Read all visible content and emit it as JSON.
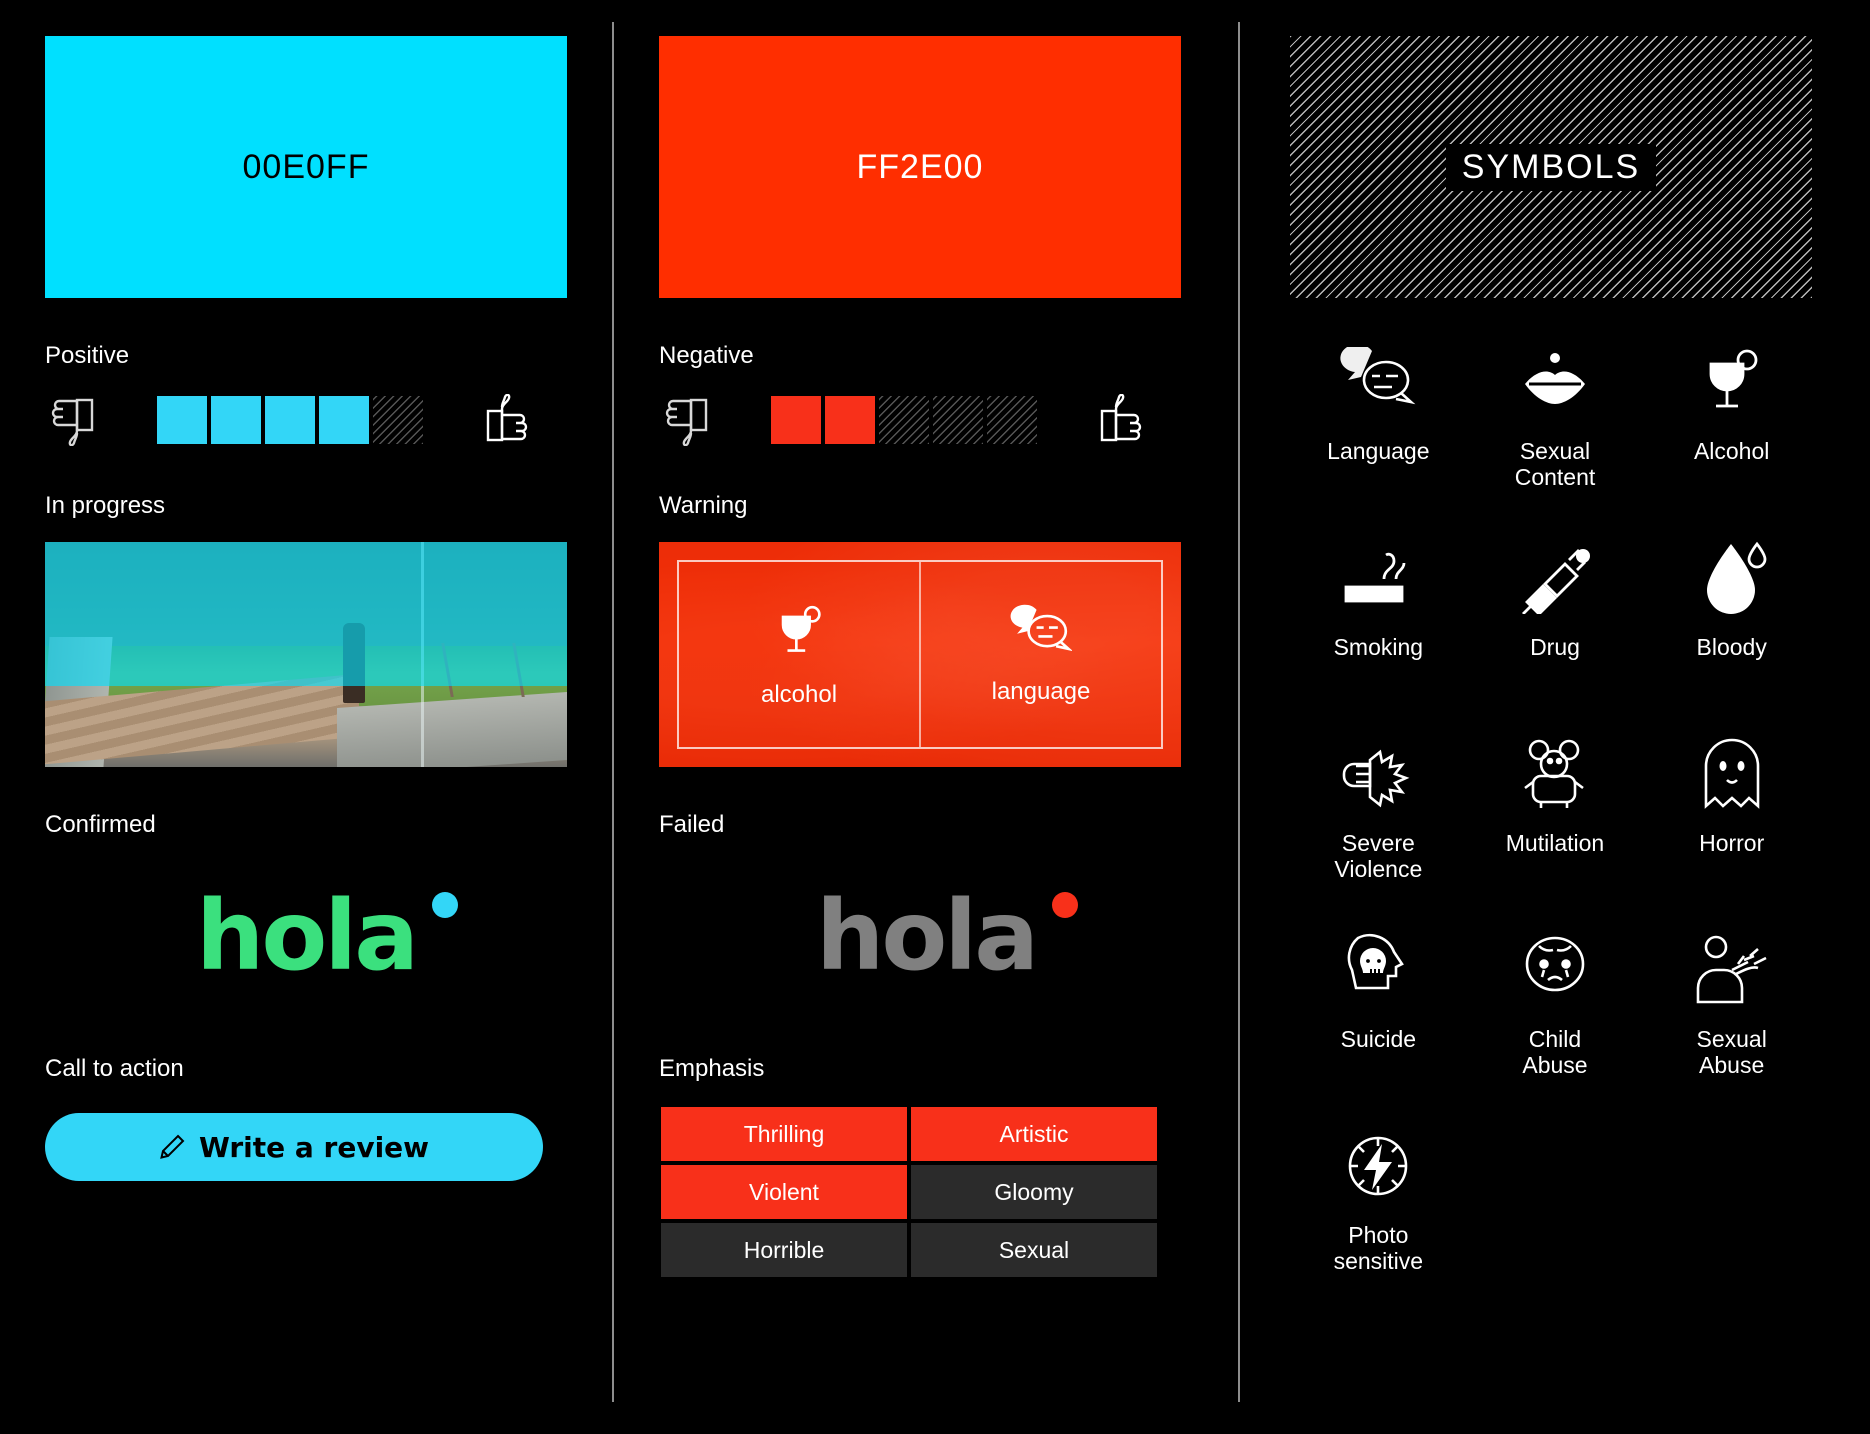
{
  "columns": {
    "primary": {
      "swatch": {
        "label": "00E0FF",
        "hex": "#00E0FF"
      },
      "positive": {
        "label": "Positive",
        "filled": 4,
        "total": 5,
        "down_icon": "thumbs-down-icon",
        "up_icon": "thumbs-up-icon"
      },
      "in_progress": {
        "label": "In progress",
        "overlay_hex": "#00E0FF",
        "progress_pct": 64
      },
      "confirmed": {
        "label": "Confirmed",
        "logo_text": "hola",
        "logo_hex": "#3BE07E",
        "dot_hex": "#33D6F7"
      },
      "cta": {
        "label": "Call to action",
        "button_text": "Write a review",
        "button_icon": "pencil-icon",
        "button_hex": "#33D6F7"
      }
    },
    "secondary": {
      "swatch": {
        "label": "FF2E00",
        "hex": "#FF2E00"
      },
      "negative": {
        "label": "Negative",
        "filled": 2,
        "total": 5,
        "down_icon": "thumbs-down-icon",
        "up_icon": "thumbs-up-icon"
      },
      "warning": {
        "label": "Warning",
        "cells": [
          {
            "icon": "alcohol-icon",
            "label": "alcohol"
          },
          {
            "icon": "language-icon",
            "label": "language"
          }
        ]
      },
      "failed": {
        "label": "Failed",
        "logo_text": "hola",
        "logo_hex": "#808080",
        "dot_hex": "#F8301A"
      },
      "emphasis": {
        "label": "Emphasis",
        "rows": [
          [
            {
              "text": "Thrilling",
              "on": true
            },
            {
              "text": "Artistic",
              "on": true
            }
          ],
          [
            {
              "text": "Violent",
              "on": true
            },
            {
              "text": "Gloomy",
              "on": false
            }
          ],
          [
            {
              "text": "Horrible",
              "on": false
            },
            {
              "text": "Sexual",
              "on": false
            }
          ]
        ]
      }
    },
    "symbols": {
      "title": "SYMBOLS",
      "items": [
        {
          "icon": "language-icon",
          "label": "Language"
        },
        {
          "icon": "sexual-content-icon",
          "label": "Sexual\nContent"
        },
        {
          "icon": "alcohol-icon",
          "label": "Alcohol"
        },
        {
          "icon": "smoking-icon",
          "label": "Smoking"
        },
        {
          "icon": "drug-icon",
          "label": "Drug"
        },
        {
          "icon": "bloody-icon",
          "label": "Bloody"
        },
        {
          "icon": "severe-violence-icon",
          "label": "Severe\nViolence"
        },
        {
          "icon": "mutilation-icon",
          "label": "Mutilation"
        },
        {
          "icon": "horror-icon",
          "label": "Horror"
        },
        {
          "icon": "suicide-icon",
          "label": "Suicide"
        },
        {
          "icon": "child-abuse-icon",
          "label": "Child\nAbuse"
        },
        {
          "icon": "sexual-abuse-icon",
          "label": "Sexual\nAbuse"
        },
        {
          "icon": "photosensitive-icon",
          "label": "Photo\nsensitive"
        }
      ]
    }
  }
}
